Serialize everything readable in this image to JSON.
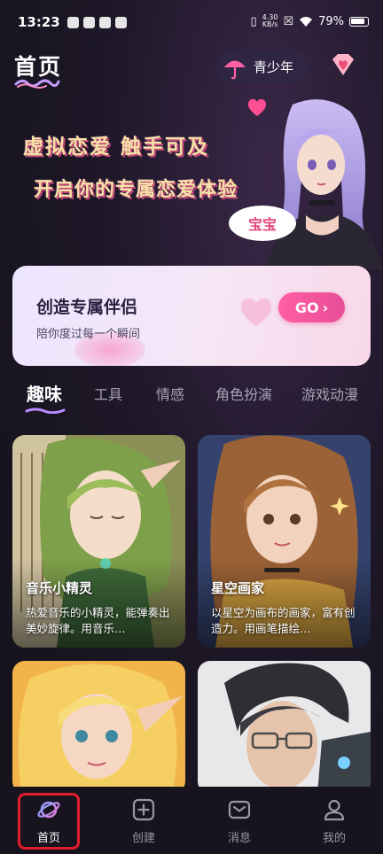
{
  "status_bar": {
    "time": "13:23",
    "net_speed_value": "4.30",
    "net_speed_unit": "KB/s",
    "battery": "79%"
  },
  "header": {
    "title": "首页",
    "teen_mode_label": "青少年"
  },
  "banner": {
    "line1": "虚拟恋爱  触手可及",
    "line2": "开启你的专属恋爱体验",
    "bubble_text": "宝宝"
  },
  "create_card": {
    "title": "创造专属伴侣",
    "subtitle": "陪你度过每一个瞬间",
    "go_label": "GO"
  },
  "tabs": [
    {
      "label": "趣味",
      "active": true
    },
    {
      "label": "工具",
      "active": false
    },
    {
      "label": "情感",
      "active": false
    },
    {
      "label": "角色扮演",
      "active": false
    },
    {
      "label": "游戏动漫",
      "active": false
    }
  ],
  "cards": [
    {
      "name": "音乐小精灵",
      "desc": "热爱音乐的小精灵，能弹奏出美妙旋律。用音乐…"
    },
    {
      "name": "星空画家",
      "desc": "以星空为画布的画家，富有创造力。用画笔描绘…"
    },
    {
      "name": "",
      "desc": ""
    },
    {
      "name": "",
      "desc": ""
    }
  ],
  "bottom_nav": [
    {
      "label": "首页",
      "icon": "planet-icon",
      "active": true
    },
    {
      "label": "创建",
      "icon": "plus-square-icon",
      "active": false
    },
    {
      "label": "消息",
      "icon": "envelope-icon",
      "active": false
    },
    {
      "label": "我的",
      "icon": "person-icon",
      "active": false
    }
  ],
  "colors": {
    "accent_pink": "#e84d98",
    "highlight_red": "#e31c2b",
    "background": "#17141f"
  }
}
